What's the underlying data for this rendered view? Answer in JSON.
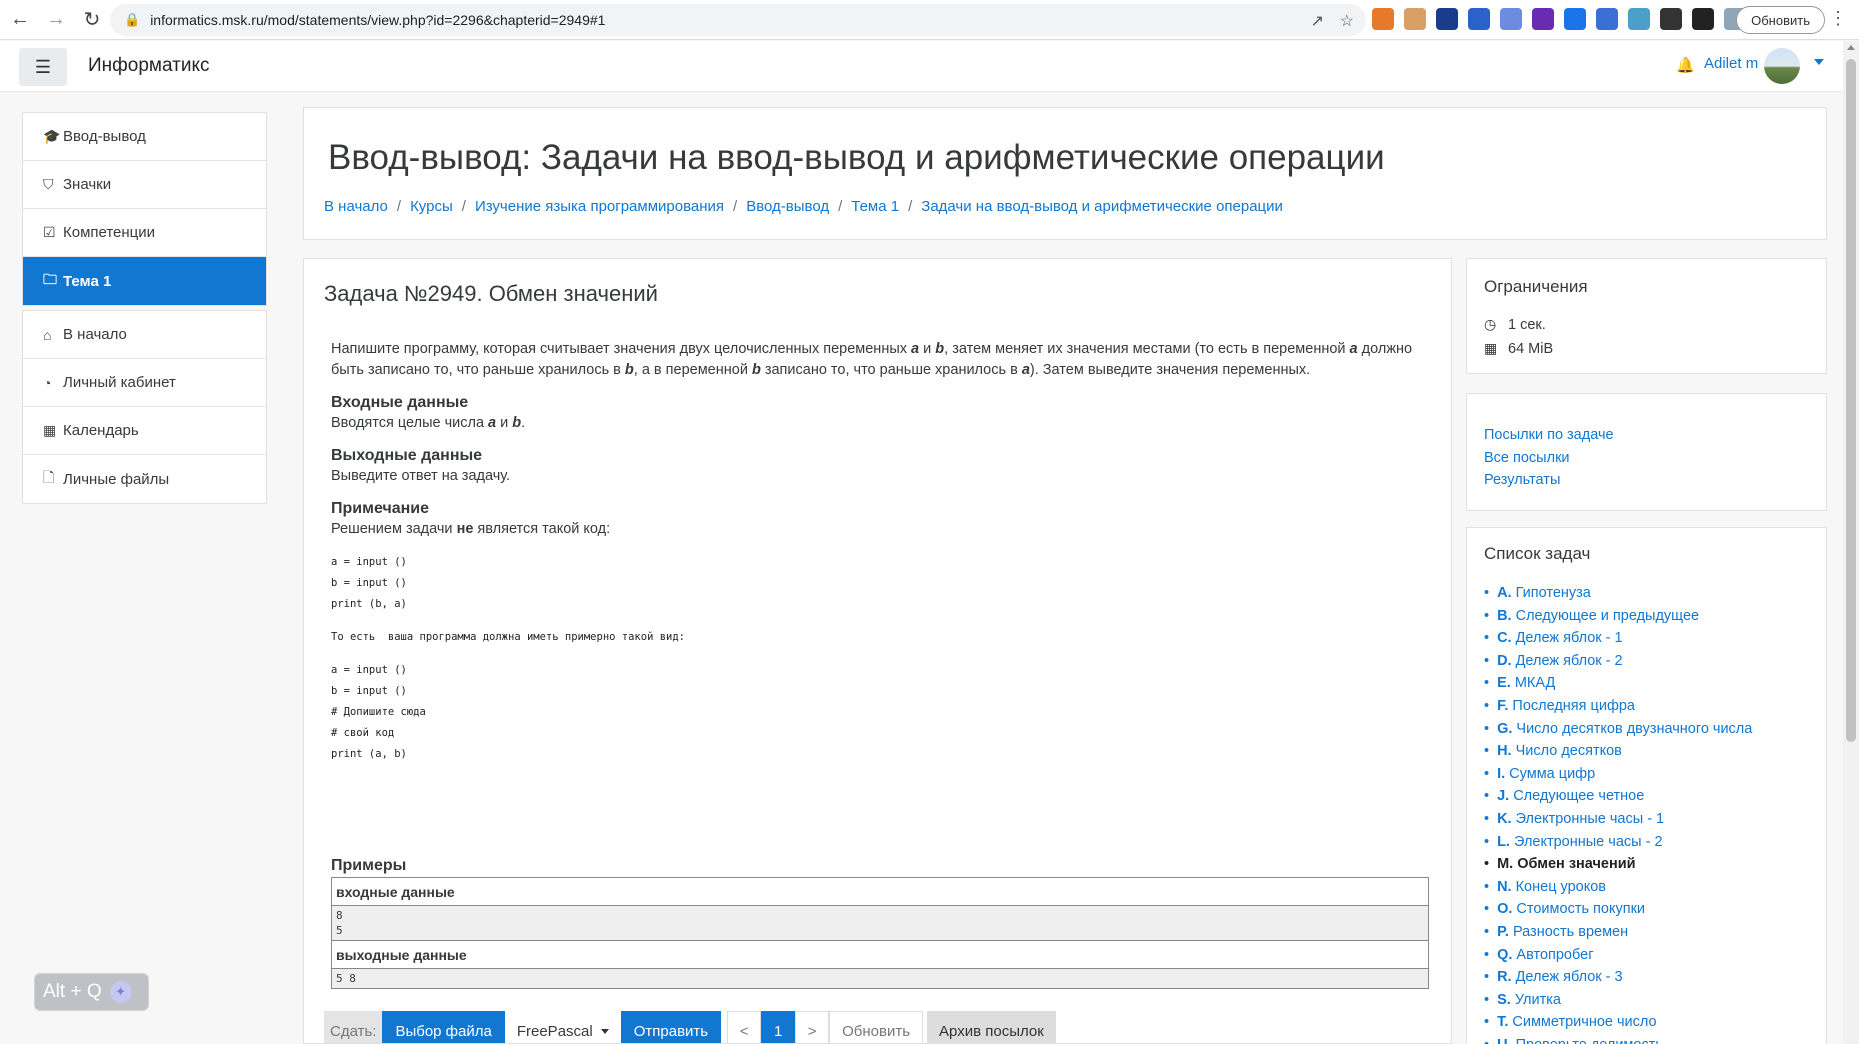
{
  "browser": {
    "url": "informatics.msk.ru/mod/statements/view.php?id=2296&chapterid=2949#1",
    "update_label": "Обновить",
    "extensions": [
      "#e8792b",
      "#d9a066",
      "#1a3c8c",
      "#2a62c9",
      "#6d8be0",
      "#6a2bb3",
      "#1a73e8",
      "#3b6fd6",
      "#4aa0c8",
      "#333333",
      "#222222",
      "#8fa6b8"
    ]
  },
  "navbar": {
    "brand": "Информатикс",
    "user_name": "Adilet m"
  },
  "sidebar": {
    "group1": [
      {
        "icon": "graduation-cap-icon",
        "glyph": "🎓",
        "label": "Ввод-вывод"
      },
      {
        "icon": "shield-icon",
        "glyph": "⛉",
        "label": "Значки"
      },
      {
        "icon": "checkbox-icon",
        "glyph": "☑",
        "label": "Компетенции"
      },
      {
        "icon": "folder-icon",
        "glyph": "🗀",
        "label": "Тема 1",
        "active": true
      }
    ],
    "group2": [
      {
        "icon": "home-icon",
        "glyph": "⌂",
        "label": "В начало"
      },
      {
        "icon": "dashboard-icon",
        "glyph": "◔",
        "label": "Личный кабинет"
      },
      {
        "icon": "calendar-icon",
        "glyph": "▦",
        "label": "Календарь"
      },
      {
        "icon": "file-icon",
        "glyph": "🗋",
        "label": "Личные файлы"
      }
    ]
  },
  "header": {
    "title": "Ввод-вывод: Задачи на ввод-вывод и арифметические операции",
    "breadcrumb": [
      "В начало",
      "Курсы",
      "Изучение языка программирования",
      "Ввод-вывод",
      "Тема 1",
      "Задачи на ввод-вывод и арифметические операции"
    ]
  },
  "problem": {
    "title": "Задача №2949. Обмен значений",
    "statement_parts": [
      {
        "t": "Напишите программу, которая считывает значения двух целочисленных переменных "
      },
      {
        "t": "a",
        "v": true
      },
      {
        "t": " и "
      },
      {
        "t": "b",
        "v": true
      },
      {
        "t": ", затем меняет их значения местами (то есть в переменной "
      },
      {
        "t": "a",
        "v": true
      },
      {
        "t": " должно быть записано то, что раньше хранилось в "
      },
      {
        "t": "b",
        "v": true
      },
      {
        "t": ", а в переменной "
      },
      {
        "t": "b",
        "v": true
      },
      {
        "t": " записано то, что раньше хранилось в "
      },
      {
        "t": "a",
        "v": true
      },
      {
        "t": "). Затем выведите значения переменных."
      }
    ],
    "input_heading": "Входные данные",
    "input_parts": [
      {
        "t": "Вводятся целые числа "
      },
      {
        "t": "a",
        "v": true
      },
      {
        "t": " и "
      },
      {
        "t": "b",
        "v": true
      },
      {
        "t": "."
      }
    ],
    "output_heading": "Выходные данные",
    "output_text": "Выведите ответ на задачу.",
    "note_heading": "Примечание",
    "note_pre": "Решением задачи ",
    "note_bold": "не",
    "note_post": " является такой код:",
    "code1": "a = input ()\nb = input ()\nprint (b, a)",
    "code_middle": "То есть  ваша программа должна иметь примерно такой вид:",
    "code2": "a = input ()\nb = input ()\n# Допишите сюда\n# свой код\nprint (a, b)",
    "examples_heading": "Примеры",
    "example_input_label": "входные данные",
    "example_input": "8\n5",
    "example_output_label": "выходные данные",
    "example_output": "5 8"
  },
  "submit": {
    "label": "Сдать:",
    "choose_file": "Выбор файла",
    "language": "FreePascal",
    "send": "Отправить",
    "prev": "<",
    "page": "1",
    "next": ">",
    "refresh": "Обновить",
    "archive": "Архив посылок"
  },
  "limits": {
    "title": "Ограничения",
    "time": "1 сек.",
    "memory": "64 MiB"
  },
  "links": [
    "Посылки по задаче",
    "Все посылки",
    "Результаты"
  ],
  "tasks": {
    "title": "Список задач",
    "items": [
      {
        "letter": "A.",
        "name": "Гипотенуза"
      },
      {
        "letter": "B.",
        "name": "Следующее и предыдущее"
      },
      {
        "letter": "C.",
        "name": "Дележ яблок - 1"
      },
      {
        "letter": "D.",
        "name": "Дележ яблок - 2"
      },
      {
        "letter": "E.",
        "name": "МКАД"
      },
      {
        "letter": "F.",
        "name": "Последняя цифра"
      },
      {
        "letter": "G.",
        "name": "Число десятков двузначного числа"
      },
      {
        "letter": "H.",
        "name": "Число десятков"
      },
      {
        "letter": "I.",
        "name": "Сумма цифр"
      },
      {
        "letter": "J.",
        "name": "Следующее четное"
      },
      {
        "letter": "K.",
        "name": "Электронные часы - 1"
      },
      {
        "letter": "L.",
        "name": "Электронные часы - 2"
      },
      {
        "letter": "M.",
        "name": "Обмен значений",
        "current": true
      },
      {
        "letter": "N.",
        "name": "Конец уроков"
      },
      {
        "letter": "O.",
        "name": "Стоимость покупки"
      },
      {
        "letter": "P.",
        "name": "Разность времен"
      },
      {
        "letter": "Q.",
        "name": "Автопробег"
      },
      {
        "letter": "R.",
        "name": "Дележ яблок - 3"
      },
      {
        "letter": "S.",
        "name": "Улитка"
      },
      {
        "letter": "T.",
        "name": "Симметричное число"
      },
      {
        "letter": "U.",
        "name": "Проверьте делимость"
      }
    ]
  },
  "widget": {
    "label": "Alt + Q"
  }
}
